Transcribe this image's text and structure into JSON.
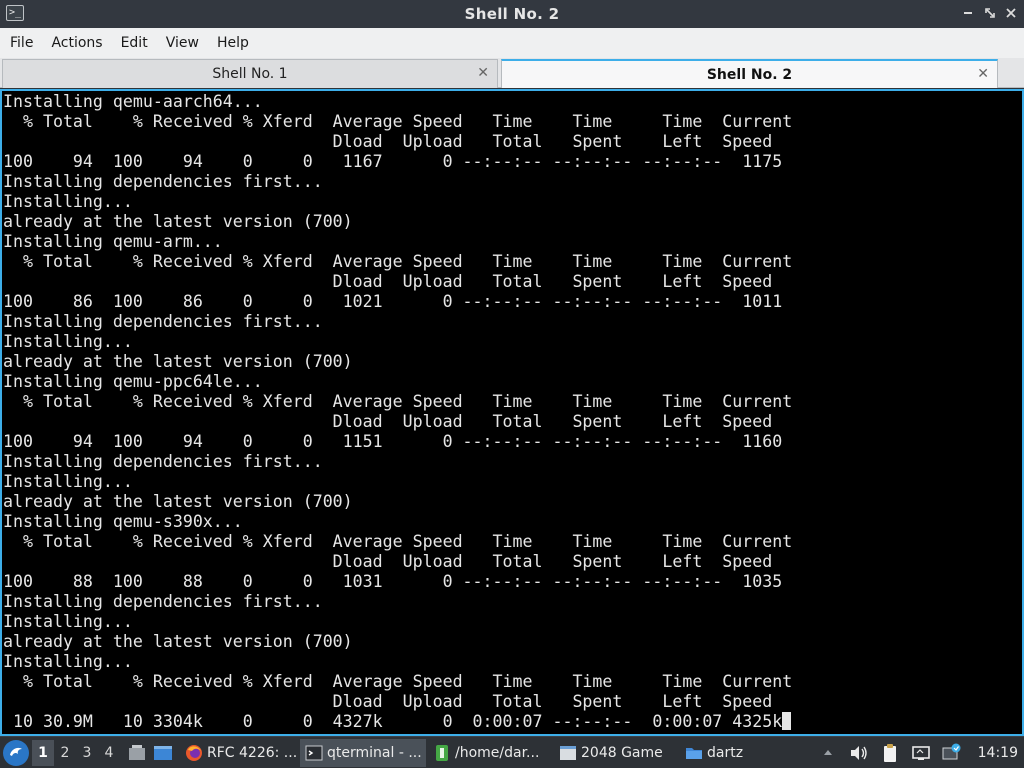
{
  "window": {
    "title": "Shell No. 2",
    "controls": [
      "minimize-icon",
      "restore-icon",
      "close-icon"
    ]
  },
  "menubar": {
    "items": [
      "File",
      "Actions",
      "Edit",
      "View",
      "Help"
    ]
  },
  "tabs": [
    {
      "label": "Shell No. 1",
      "active": false
    },
    {
      "label": "Shell No. 2",
      "active": true
    }
  ],
  "terminal": {
    "lines": [
      "Installing qemu-aarch64...",
      "  % Total    % Received % Xferd  Average Speed   Time    Time     Time  Current",
      "                                 Dload  Upload   Total   Spent    Left  Speed",
      "100    94  100    94    0     0   1167      0 --:--:-- --:--:-- --:--:--  1175",
      "Installing dependencies first...",
      "Installing...",
      "already at the latest version (700)",
      "Installing qemu-arm...",
      "  % Total    % Received % Xferd  Average Speed   Time    Time     Time  Current",
      "                                 Dload  Upload   Total   Spent    Left  Speed",
      "100    86  100    86    0     0   1021      0 --:--:-- --:--:-- --:--:--  1011",
      "Installing dependencies first...",
      "Installing...",
      "already at the latest version (700)",
      "Installing qemu-ppc64le...",
      "  % Total    % Received % Xferd  Average Speed   Time    Time     Time  Current",
      "                                 Dload  Upload   Total   Spent    Left  Speed",
      "100    94  100    94    0     0   1151      0 --:--:-- --:--:-- --:--:--  1160",
      "Installing dependencies first...",
      "Installing...",
      "already at the latest version (700)",
      "Installing qemu-s390x...",
      "  % Total    % Received % Xferd  Average Speed   Time    Time     Time  Current",
      "                                 Dload  Upload   Total   Spent    Left  Speed",
      "100    88  100    88    0     0   1031      0 --:--:-- --:--:-- --:--:--  1035",
      "Installing dependencies first...",
      "Installing...",
      "already at the latest version (700)",
      "Installing...",
      "  % Total    % Received % Xferd  Average Speed   Time    Time     Time  Current",
      "                                 Dload  Upload   Total   Spent    Left  Speed",
      " 10 30.9M   10 3304k    0     0  4327k      0  0:00:07 --:--:--  0:00:07 4325k"
    ]
  },
  "taskbar": {
    "desktops": [
      "1",
      "2",
      "3",
      "4"
    ],
    "active_desktop": "1",
    "tasks": [
      {
        "label": "RFC 4226: ...",
        "icon": "firefox-icon"
      },
      {
        "label": "qterminal - ...",
        "icon": "terminal-icon",
        "active": true
      },
      {
        "label": "/home/dar...",
        "icon": "file-manager-icon"
      },
      {
        "label": "2048 Game",
        "icon": "window-icon"
      },
      {
        "label": "dartz",
        "icon": "folder-icon"
      }
    ],
    "tray": [
      "up-arrow-icon",
      "volume-icon",
      "clipboard-icon",
      "network-icon",
      "update-icon"
    ],
    "clock": "14:19"
  },
  "colors": {
    "accent": "#3daee9",
    "terminal_bg": "#000000",
    "terminal_fg": "#e6e6e6",
    "titlebar_bg": "#333840",
    "taskbar_bg": "#2d3136"
  }
}
